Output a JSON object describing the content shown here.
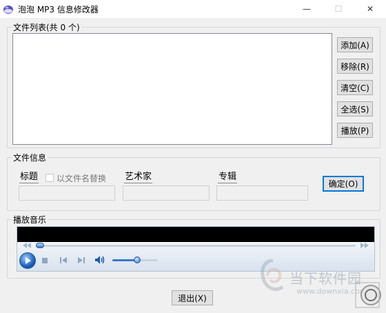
{
  "window": {
    "title": "泡泡 MP3 信息修改器",
    "controls": {
      "minimize": "—",
      "maximize": "☐",
      "close": "✕"
    }
  },
  "file_list": {
    "group_label": "文件列表(共 0 个)",
    "items": [],
    "buttons": {
      "add": "添加(A)",
      "remove": "移除(R)",
      "clear": "清空(C)",
      "select_all": "全选(S)",
      "play": "播放(P)"
    }
  },
  "file_info": {
    "group_label": "文件信息",
    "title_label": "标题",
    "title_value": "",
    "replace_checkbox_label": "以文件名替换",
    "replace_checked": false,
    "artist_label": "艺术家",
    "artist_value": "",
    "album_label": "专辑",
    "album_value": "",
    "ok_button": "确定(O)"
  },
  "player": {
    "group_label": "播放音乐",
    "seek_position": 0,
    "volume_level": 0.55,
    "icons": [
      "rewind-icon",
      "fast-forward-icon",
      "play-icon",
      "stop-icon",
      "previous-icon",
      "next-icon",
      "volume-icon"
    ]
  },
  "footer": {
    "exit_button": "退出(X)"
  },
  "watermark": {
    "brand": "当下软件园",
    "url": "www.downxia.com"
  },
  "colors": {
    "accent": "#0078d7",
    "button_bg": "#e1e1e1",
    "window_bg": "#f0f0f0"
  }
}
